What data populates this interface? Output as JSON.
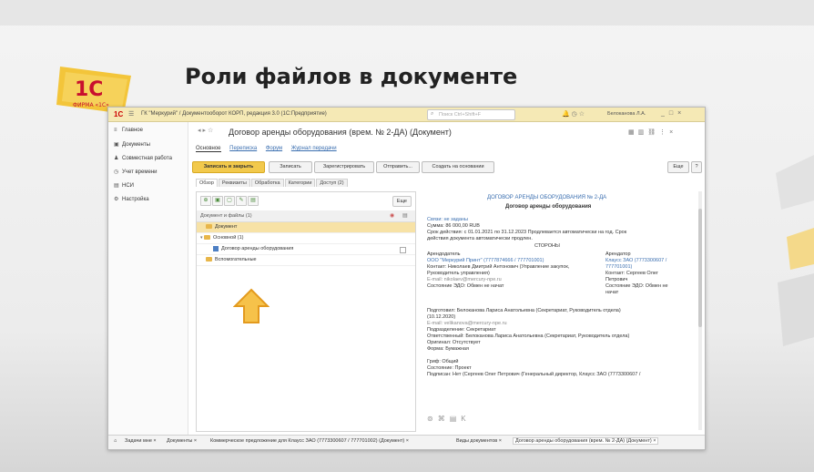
{
  "slide": {
    "title": "Роли файлов в документе",
    "logo_text": "1С",
    "logo_sub": "ФИРМА «1С»"
  },
  "window": {
    "app_title": "ГК \"Меркурий\" / Документооборот КОРП, редакция 3.0 (1С:Предприятие)",
    "search_placeholder": "Поиск Ctrl+Shift+F",
    "user": "Белоканова Л.А.",
    "menu_icon": "menu-icon"
  },
  "sidebar": {
    "items": [
      {
        "label": "Главное",
        "icon": "home-icon"
      },
      {
        "label": "Документы",
        "icon": "documents-icon"
      },
      {
        "label": "Совместная работа",
        "icon": "team-icon"
      },
      {
        "label": "Учет времени",
        "icon": "clock-icon"
      },
      {
        "label": "НСИ",
        "icon": "book-icon"
      },
      {
        "label": "Настройка",
        "icon": "settings-icon"
      }
    ]
  },
  "document": {
    "title": "Договор аренды оборудования (врем. № 2-ДА) (Документ)",
    "tabs": [
      "Основное",
      "Переписка",
      "Форум",
      "Журнал передачи"
    ],
    "toolbar": {
      "save_close": "Записать и закрыть",
      "save": "Записать",
      "register": "Зарегистрировать",
      "send": "Отправить...",
      "create_basis": "Создать на основании",
      "more": "Еще",
      "help": "?"
    },
    "subtabs": [
      "Обзор",
      "Реквизиты",
      "Обработка",
      "Категории",
      "Доступ (2)"
    ]
  },
  "files": {
    "more": "Еще",
    "header": "Документ и файлы (1)",
    "rows": [
      {
        "label": "Документ",
        "type": "folder",
        "selected": true
      },
      {
        "label": "Основной (1)",
        "type": "folder",
        "selected": false
      },
      {
        "label": "Договор аренды оборудования",
        "type": "file",
        "selected": false
      },
      {
        "label": "Вспомогательные",
        "type": "folder",
        "selected": false
      }
    ]
  },
  "preview": {
    "head": "ДОГОВОР АРЕНДЫ ОБОРУДОВАНИЯ № 2-ДА",
    "sub": "Договор аренды оборудования",
    "links_label": "Связи: не заданы",
    "sum": "Сумма: 86 000,00 RUB",
    "validity": "Срок действия: с 01.01.2021 по 31.12.2023 Продлевается автоматически на год. Срок",
    "validity2": "действия документа автоматически продлен.",
    "parties": "СТОРОНЫ",
    "lessor_label": "Арендодатель",
    "lessor": "ООО \"Меркурий Принт\" (7777874666 / 777701001)",
    "lessor_contact": "Контакт: Николаев Дмитрий Антонович (Управление закупок,",
    "lessor_contact2": "Руководитель управления)",
    "lessor_email": "E-mail: nikolaev@mercury-npe.ru",
    "lessor_edo": "Состояние ЭДО: Обмен не начат",
    "lessee_label": "Арендатор",
    "lessee": "Клаусс ЗАО (7773300607 /",
    "lessee2": "777701001)",
    "lessee_contact": "Контакт: Сергеев Олег",
    "lessee_contact2": "Петрович",
    "lessee_edo": "Состояние ЭДО: Обмен не",
    "lessee_edo2": "начат",
    "signed": "Подготовил: Белоканова Лариса Анатольевна (Секретариат, Руководитель отдела)",
    "signed_date": "(10.12.2020)",
    "signed_email": "E-mail: velikanova@mercury-npe.ru",
    "dept": "Подразделение: Секретариат",
    "responsible": "Ответственный: Белоканова Лариса Анатольевна (Секретариат, Руководитель отдела)",
    "original": "Оригинал: Отсутствует",
    "form": "Форма: Бумажная",
    "stamp": "Гриф: Общий",
    "status": "Состояние: Проект",
    "signer": "Подписан: Нет (Сергеев Олег Петрович (Генеральный директор, Клаусс ЗАО (7773300607 /"
  },
  "taskbar": {
    "items": [
      "Задачи мне ×",
      "Документы ×",
      "Коммерческое предложение для Клаусс ЗАО (7773300607 / 777701002) (Документ) ×",
      "Виды документов ×",
      "Договор аренды оборудования (врем. № 2-ДА) (Документ) ×"
    ]
  }
}
